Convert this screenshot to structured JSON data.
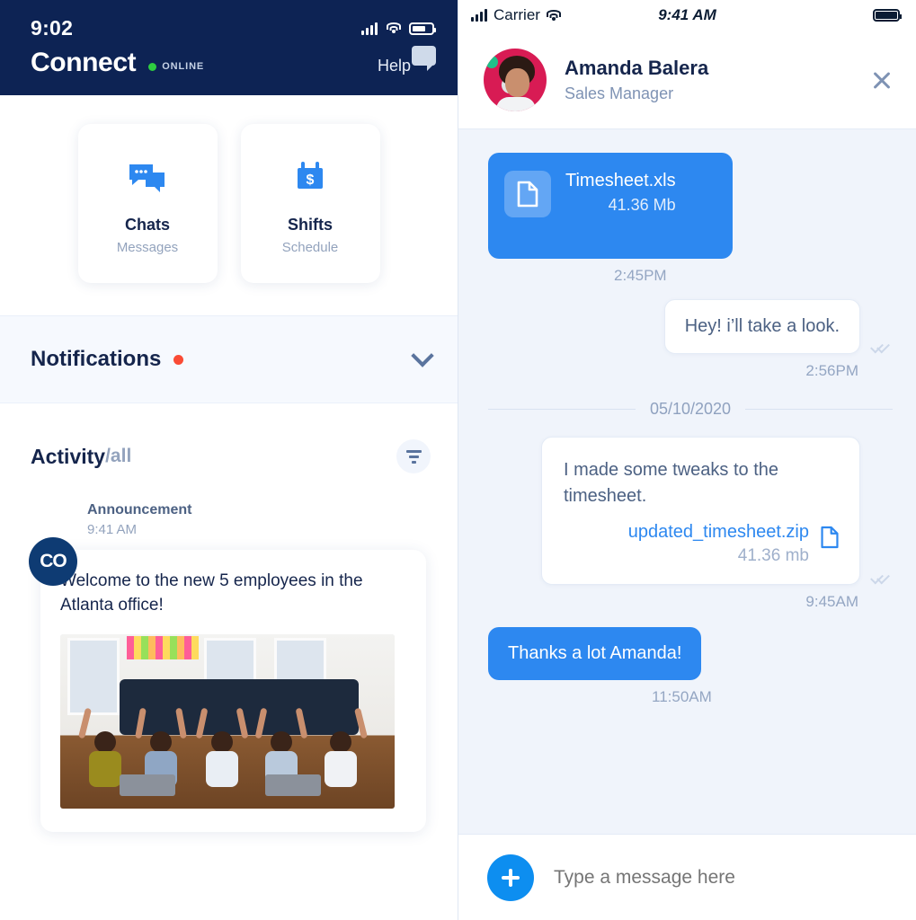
{
  "left_panel": {
    "status_bar": {
      "time": "9:02",
      "signal_icon": "signal-bars-icon",
      "wifi_icon": "wifi-icon",
      "battery_icon": "battery-icon"
    },
    "header": {
      "title": "Connect",
      "status_label": "ONLINE",
      "status_color": "#2ecc40",
      "help_label": "Help",
      "help_icon": "chat-bubble-icon",
      "background": "#0d2354"
    },
    "cards": [
      {
        "title": "Chats",
        "subtitle": "Messages",
        "icon": "chat-bubbles-icon"
      },
      {
        "title": "Shifts",
        "subtitle": "Schedule",
        "icon": "calendar-dollar-icon"
      }
    ],
    "notifications": {
      "title": "Notifications",
      "badge_color": "#fa4b35",
      "badge_icon": "red-dot-badge",
      "expand_icon": "chevron-down-icon"
    },
    "activity": {
      "title": "Activity",
      "subtitle": "/all",
      "filter_icon": "filter-icon"
    },
    "announcement": {
      "avatar_initials": "CO",
      "label": "Announcement",
      "time": "9:41 AM",
      "text": "Welcome to the new 5 employees in the Atlanta office!",
      "photo_alt": "team-celebration-photo"
    }
  },
  "right_panel": {
    "status_bar": {
      "carrier": "Carrier",
      "time": "9:41 AM",
      "signal_icon": "signal-bars-icon",
      "wifi_icon": "wifi-icon",
      "battery_icon": "battery-full-icon"
    },
    "contact": {
      "name": "Amanda Balera",
      "role": "Sales Manager",
      "avatar": "amanda-avatar",
      "online_color": "#1fc08a",
      "close_icon": "close-icon"
    },
    "messages": [
      {
        "type": "file",
        "direction": "outgoing",
        "file_name": "Timesheet.xls",
        "file_size": "41.36 Mb",
        "time": "2:45PM",
        "icon": "document-icon"
      },
      {
        "type": "text",
        "direction": "incoming",
        "text": "Hey! i’ll take a look.",
        "time": "2:56PM",
        "receipt_icon": "double-check-icon"
      },
      {
        "type": "divider",
        "date": "05/10/2020"
      },
      {
        "type": "text_attachment",
        "direction": "incoming",
        "text": "I made some tweaks to the timesheet.",
        "attachment_name": "updated_timesheet.zip",
        "attachment_size": "41.36 mb",
        "attachment_icon": "document-icon",
        "time": "9:45AM",
        "receipt_icon": "double-check-icon"
      },
      {
        "type": "text",
        "direction": "outgoing",
        "text": "Thanks a lot Amanda!",
        "time": "11:50AM"
      }
    ],
    "composer": {
      "add_icon": "plus-icon",
      "placeholder": "Type a message here",
      "value": ""
    },
    "accent_color": "#2d88f0",
    "background": "#f0f4fb"
  }
}
